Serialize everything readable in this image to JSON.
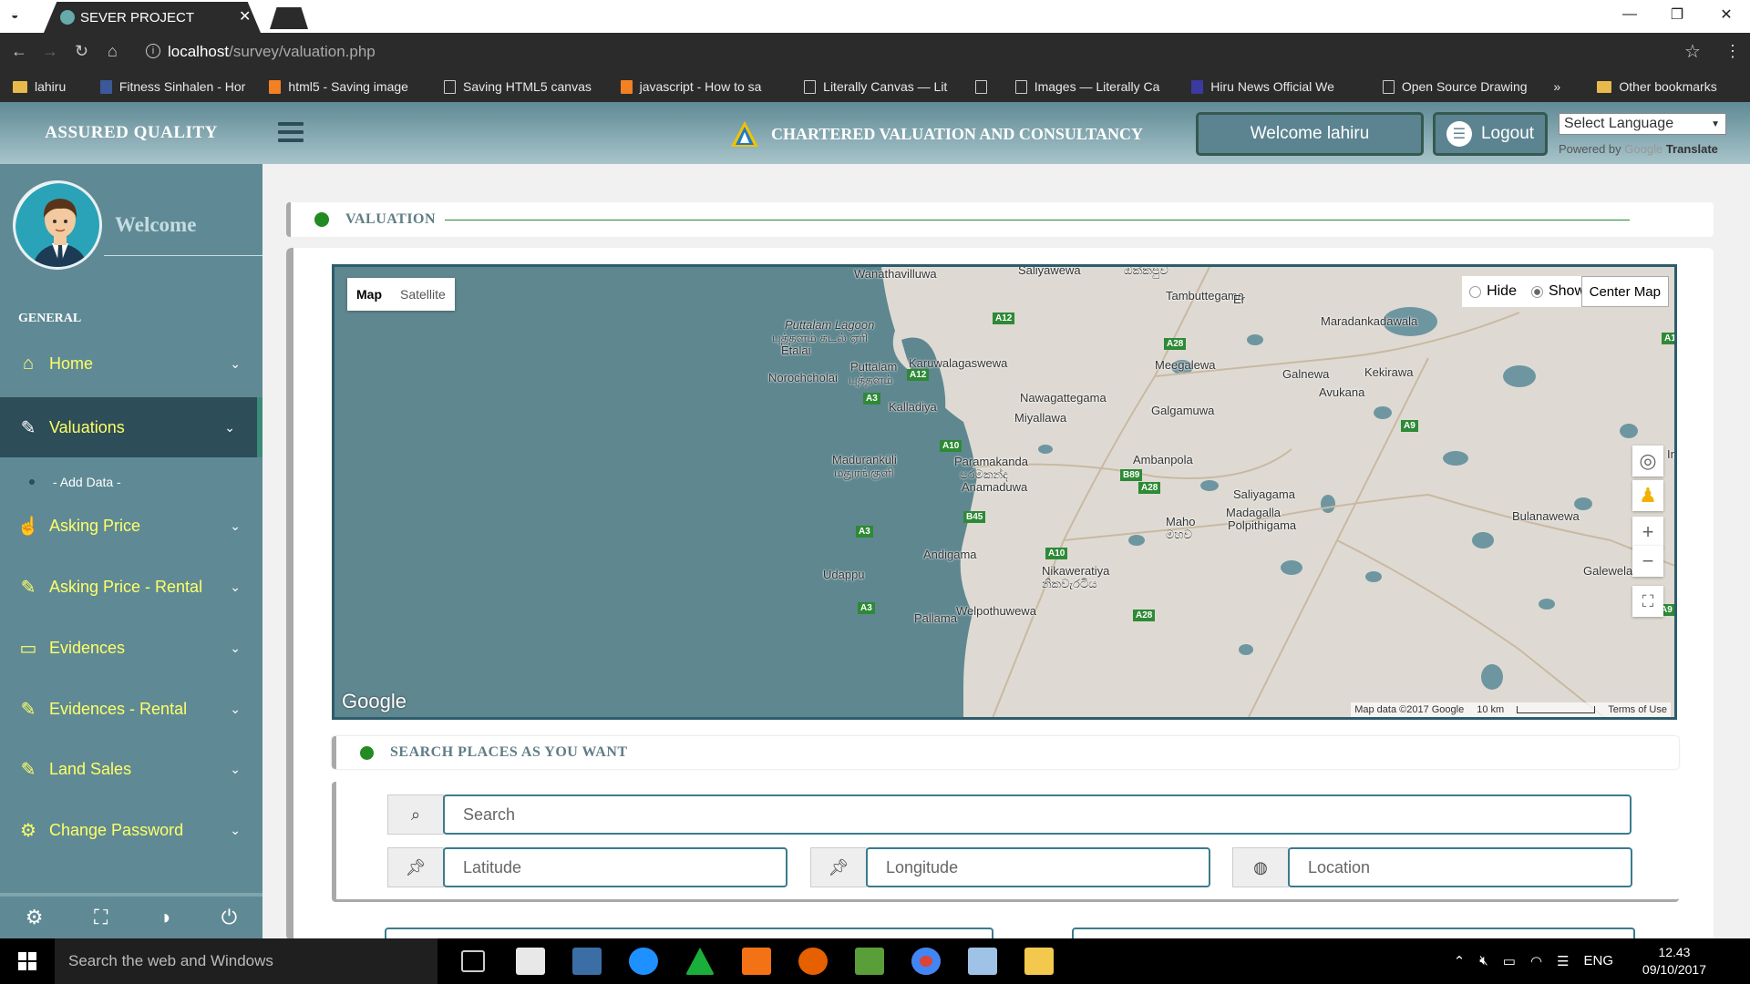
{
  "browser": {
    "tab_title": "SEVER PROJECT",
    "url_host": "localhost",
    "url_path": "/survey/valuation.php",
    "bookmarks": [
      {
        "label": "lahiru",
        "kind": "folder"
      },
      {
        "label": "Fitness Sinhalen - Hor",
        "kind": "page"
      },
      {
        "label": "html5 - Saving image",
        "kind": "page"
      },
      {
        "label": "Saving HTML5 canvas",
        "kind": "page"
      },
      {
        "label": "javascript - How to sa",
        "kind": "page"
      },
      {
        "label": "Literally Canvas — Lit",
        "kind": "page"
      },
      {
        "label": "",
        "kind": "page"
      },
      {
        "label": "Images — Literally Ca",
        "kind": "page"
      },
      {
        "label": "Hiru News Official We",
        "kind": "page"
      },
      {
        "label": "Open Source Drawing",
        "kind": "page"
      }
    ],
    "more_bookmarks": "»",
    "other_bookmarks": "Other bookmarks"
  },
  "header": {
    "brand": "ASSURED QUALITY",
    "company": "CHARTERED VALUATION AND CONSULTANCY",
    "welcome_button": "Welcome lahiru",
    "logout_button": "Logout",
    "language_select": "Select Language",
    "powered_by": "Powered by",
    "google": "Google",
    "translate": "Translate"
  },
  "sidebar": {
    "welcome": "Welcome",
    "section": "GENERAL",
    "items": [
      {
        "label": "Home",
        "icon": "home-icon"
      },
      {
        "label": "Valuations",
        "icon": "edit-icon"
      },
      {
        "label": "Asking Price",
        "icon": "thumbs-up-icon"
      },
      {
        "label": "Asking Price - Rental",
        "icon": "edit-icon"
      },
      {
        "label": "Evidences",
        "icon": "inbox-icon"
      },
      {
        "label": "Evidences - Rental",
        "icon": "edit-icon"
      },
      {
        "label": "Land Sales",
        "icon": "edit-icon"
      },
      {
        "label": "Change Password",
        "icon": "gear-icon"
      }
    ],
    "subitem": "- Add Data -"
  },
  "main": {
    "section_title": "VALUATION",
    "search_title": "SEARCH PLACES AS YOU WANT",
    "search_placeholder": "Search",
    "latitude_placeholder": "Latitude",
    "longitude_placeholder": "Longitude",
    "location_placeholder": "Location"
  },
  "map": {
    "type_map": "Map",
    "type_satellite": "Satellite",
    "hide": "Hide",
    "show": "Show",
    "center": "Center Map",
    "google": "Google",
    "attribution": "Map data ©2017 Google",
    "scale": "10 km",
    "terms": "Terms of Use",
    "places": [
      "Wanathavilluwa",
      "Saliyawewa",
      "ඔක්කපුව",
      "Tambuttegama",
      "Er",
      "Maradankadawala",
      "Puttalam Lagoon",
      "புத்தளம் கடல் ஏரி",
      "Etalai",
      "Norochcholai",
      "Puttalam",
      "புத்தளம்",
      "Karuwalagaswewa",
      "Meegalewa",
      "Galnewa",
      "Kekirawa",
      "Avukana",
      "Nawagattegama",
      "Kalladiya",
      "Miyallawa",
      "Galgamuwa",
      "Maduranküli",
      "மதுரங்குளி",
      "Paramakanda",
      "පරමකන්ද",
      "Anamaduwa",
      "Ambanpola",
      "Saliyagama",
      "Madagalla",
      "Polpithigama",
      "Bulanawewa",
      "Maho",
      "මහව",
      "Andigama",
      "Udappu",
      "Nikaweratiya",
      "නිකවැරටිය",
      "Galewela",
      "Welpothuwewa",
      "Pallama",
      "In"
    ],
    "roads": [
      "A12",
      "A28",
      "A12",
      "A3",
      "A10",
      "B89",
      "A28",
      "A9",
      "B45",
      "A3",
      "A10",
      "A3",
      "A28",
      "A9",
      "A1"
    ]
  },
  "taskbar": {
    "search": "Search the web and Windows",
    "language": "ENG",
    "time": "12.43",
    "date": "09/10/2017"
  }
}
